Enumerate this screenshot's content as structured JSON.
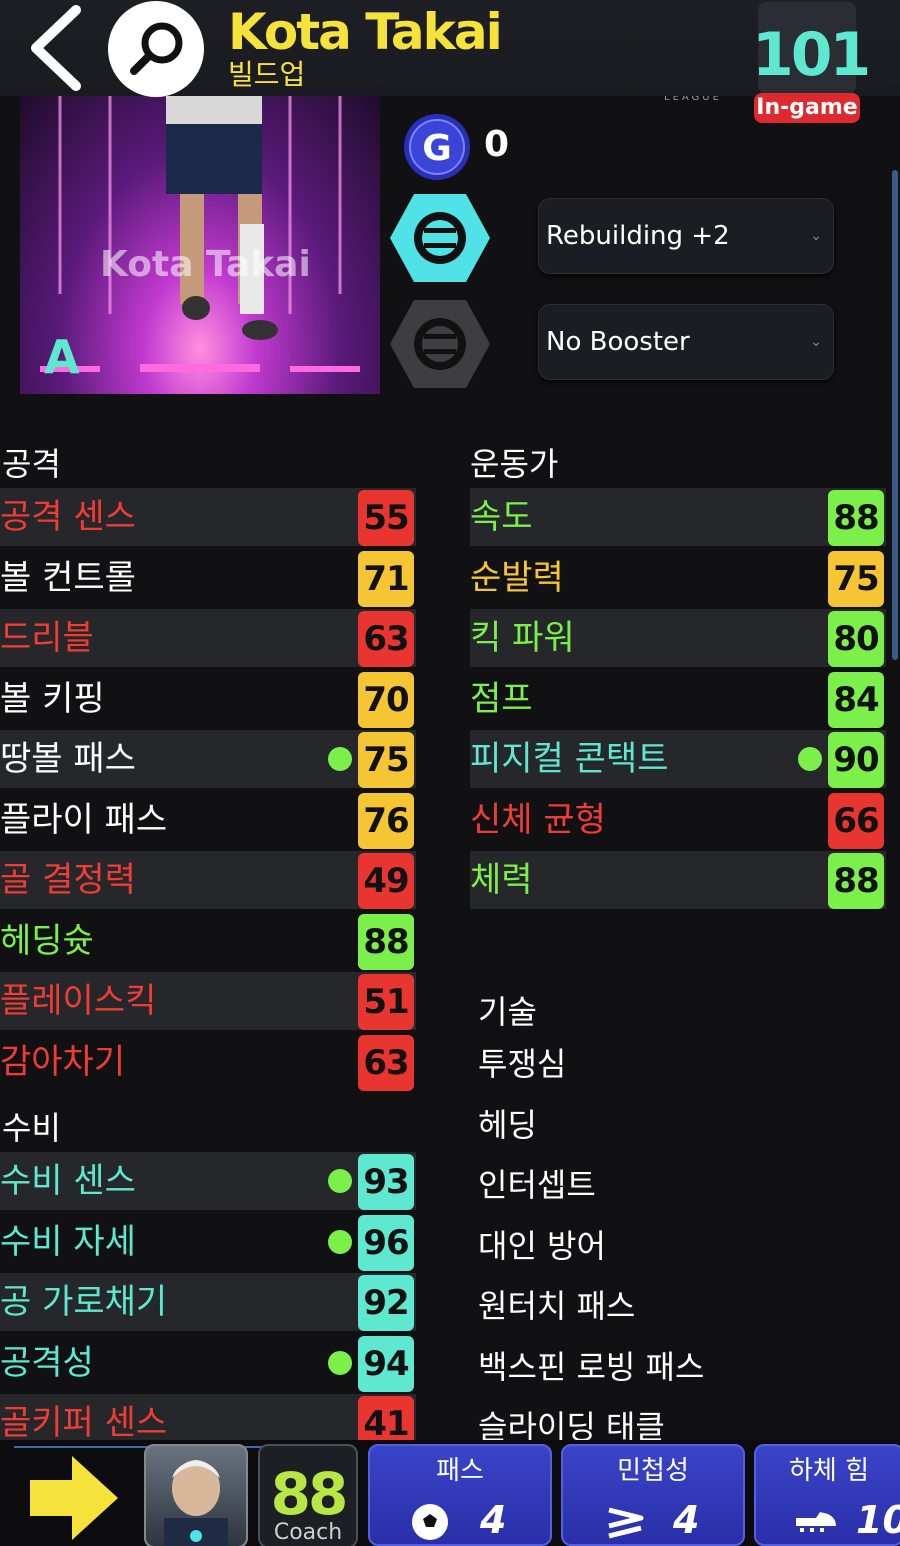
{
  "header": {
    "player_name": "Kota Takai",
    "player_role": "빌드업",
    "overall": "101",
    "overall_badge": "In-game",
    "league_text": "LEAGUE"
  },
  "card": {
    "watermark_name": "Kota Takai",
    "grade": "A",
    "gp_value": "0",
    "rebuild_select": "Rebuilding +2",
    "booster_select": "No Booster"
  },
  "attack": {
    "title": "공격",
    "stats": [
      {
        "label": "공격 센스",
        "value": "55",
        "label_color": "#f03c34",
        "box_color": "#e8352f",
        "dot": false
      },
      {
        "label": "볼 컨트롤",
        "value": "71",
        "label_color": "#ffffff",
        "box_color": "#f5c534",
        "dot": false
      },
      {
        "label": "드리블",
        "value": "63",
        "label_color": "#f03c34",
        "box_color": "#e8352f",
        "dot": false
      },
      {
        "label": "볼 키핑",
        "value": "70",
        "label_color": "#ffffff",
        "box_color": "#f5c534",
        "dot": false
      },
      {
        "label": "땅볼 패스",
        "value": "75",
        "label_color": "#ffffff",
        "box_color": "#f5c534",
        "dot": true
      },
      {
        "label": "플라이 패스",
        "value": "76",
        "label_color": "#ffffff",
        "box_color": "#f5c534",
        "dot": false
      },
      {
        "label": "골 결정력",
        "value": "49",
        "label_color": "#f03c34",
        "box_color": "#e8352f",
        "dot": false
      },
      {
        "label": "헤딩슛",
        "value": "88",
        "label_color": "#7cf04a",
        "box_color": "#7cf04a",
        "dot": false
      },
      {
        "label": "플레이스킥",
        "value": "51",
        "label_color": "#f03c34",
        "box_color": "#e8352f",
        "dot": false
      },
      {
        "label": "감아차기",
        "value": "63",
        "label_color": "#f03c34",
        "box_color": "#e8352f",
        "dot": false
      }
    ]
  },
  "defense": {
    "title": "수비",
    "stats": [
      {
        "label": "수비 센스",
        "value": "93",
        "label_color": "#5ee8d0",
        "box_color": "#5ee8d0",
        "dot": true
      },
      {
        "label": "수비 자세",
        "value": "96",
        "label_color": "#5ee8d0",
        "box_color": "#5ee8d0",
        "dot": true
      },
      {
        "label": "공 가로채기",
        "value": "92",
        "label_color": "#5ee8d0",
        "box_color": "#5ee8d0",
        "dot": false
      },
      {
        "label": "공격성",
        "value": "94",
        "label_color": "#5ee8d0",
        "box_color": "#5ee8d0",
        "dot": true
      },
      {
        "label": "골키퍼 센스",
        "value": "41",
        "label_color": "#f03c34",
        "box_color": "#e8352f",
        "dot": false
      }
    ]
  },
  "athletic": {
    "title": "운동가",
    "stats": [
      {
        "label": "속도",
        "value": "88",
        "label_color": "#7cf04a",
        "box_color": "#7cf04a",
        "dot": false
      },
      {
        "label": "순발력",
        "value": "75",
        "label_color": "#f5c534",
        "box_color": "#f5c534",
        "dot": false
      },
      {
        "label": "킥 파워",
        "value": "80",
        "label_color": "#7cf04a",
        "box_color": "#7cf04a",
        "dot": false
      },
      {
        "label": "점프",
        "value": "84",
        "label_color": "#7cf04a",
        "box_color": "#7cf04a",
        "dot": false
      },
      {
        "label": "피지컬 콘택트",
        "value": "90",
        "label_color": "#5ee8d0",
        "box_color": "#7cf04a",
        "dot": true
      },
      {
        "label": "신체 균형",
        "value": "66",
        "label_color": "#f03c34",
        "box_color": "#e8352f",
        "dot": false
      },
      {
        "label": "체력",
        "value": "88",
        "label_color": "#7cf04a",
        "box_color": "#7cf04a",
        "dot": false
      }
    ]
  },
  "skills": {
    "title": "기술",
    "items": [
      "투쟁심",
      "헤딩",
      "인터셉트",
      "대인 방어",
      "원터치 패스",
      "백스핀 로빙 패스",
      "슬라이딩 태클"
    ]
  },
  "bottom": {
    "coach_value": "88",
    "coach_label": "Coach",
    "cards": [
      {
        "title": "패스",
        "value": "4",
        "icon": "soccer-ball-icon"
      },
      {
        "title": "민첩성",
        "value": "4",
        "icon": "agility-icon"
      },
      {
        "title": "하체 힘",
        "value": "10",
        "icon": "boot-icon"
      }
    ]
  }
}
